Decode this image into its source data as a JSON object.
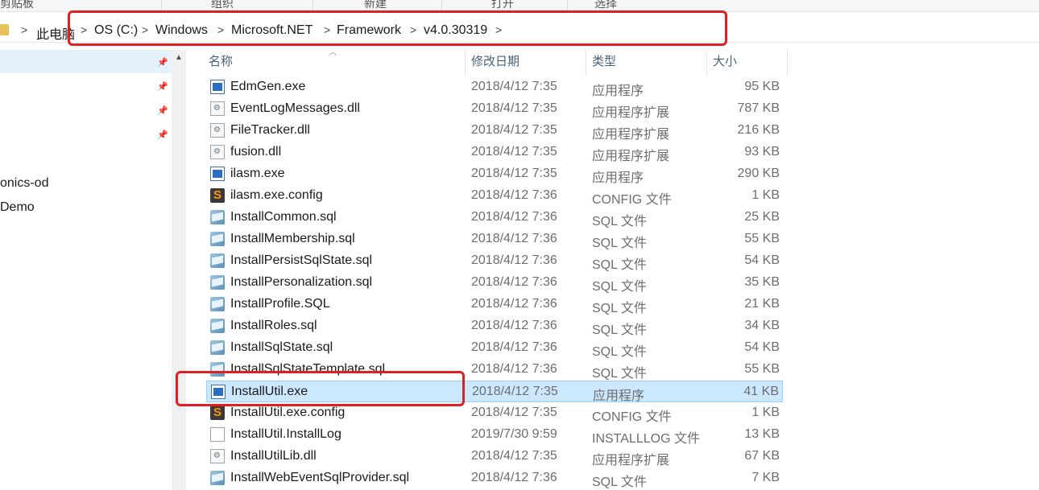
{
  "ribbon": {
    "groups": [
      "剪贴板",
      "组织",
      "新建",
      "打开",
      "选择"
    ]
  },
  "breadcrumb": [
    "此电脑",
    "OS (C:)",
    "Windows",
    "Microsoft.NET",
    "Framework",
    "v4.0.30319"
  ],
  "nav": {
    "items": [
      "onics-od",
      "Demo"
    ]
  },
  "columns": {
    "name": "名称",
    "date": "修改日期",
    "type": "类型",
    "size": "大小"
  },
  "files": [
    {
      "name": "EdmGen.exe",
      "date": "2018/4/12 7:35",
      "type": "应用程序",
      "size": "95 KB",
      "icon": "exe"
    },
    {
      "name": "EventLogMessages.dll",
      "date": "2018/4/12 7:35",
      "type": "应用程序扩展",
      "size": "787 KB",
      "icon": "dll"
    },
    {
      "name": "FileTracker.dll",
      "date": "2018/4/12 7:35",
      "type": "应用程序扩展",
      "size": "216 KB",
      "icon": "dll"
    },
    {
      "name": "fusion.dll",
      "date": "2018/4/12 7:35",
      "type": "应用程序扩展",
      "size": "93 KB",
      "icon": "dll"
    },
    {
      "name": "ilasm.exe",
      "date": "2018/4/12 7:35",
      "type": "应用程序",
      "size": "290 KB",
      "icon": "exe"
    },
    {
      "name": "ilasm.exe.config",
      "date": "2018/4/12 7:36",
      "type": "CONFIG 文件",
      "size": "1 KB",
      "icon": "config"
    },
    {
      "name": "InstallCommon.sql",
      "date": "2018/4/12 7:36",
      "type": "SQL 文件",
      "size": "25 KB",
      "icon": "sql"
    },
    {
      "name": "InstallMembership.sql",
      "date": "2018/4/12 7:36",
      "type": "SQL 文件",
      "size": "55 KB",
      "icon": "sql"
    },
    {
      "name": "InstallPersistSqlState.sql",
      "date": "2018/4/12 7:36",
      "type": "SQL 文件",
      "size": "54 KB",
      "icon": "sql"
    },
    {
      "name": "InstallPersonalization.sql",
      "date": "2018/4/12 7:36",
      "type": "SQL 文件",
      "size": "35 KB",
      "icon": "sql"
    },
    {
      "name": "InstallProfile.SQL",
      "date": "2018/4/12 7:36",
      "type": "SQL 文件",
      "size": "21 KB",
      "icon": "sql"
    },
    {
      "name": "InstallRoles.sql",
      "date": "2018/4/12 7:36",
      "type": "SQL 文件",
      "size": "34 KB",
      "icon": "sql"
    },
    {
      "name": "InstallSqlState.sql",
      "date": "2018/4/12 7:36",
      "type": "SQL 文件",
      "size": "54 KB",
      "icon": "sql"
    },
    {
      "name": "InstallSqlStateTemplate.sql",
      "date": "2018/4/12 7:36",
      "type": "SQL 文件",
      "size": "55 KB",
      "icon": "sql"
    },
    {
      "name": "InstallUtil.exe",
      "date": "2018/4/12 7:35",
      "type": "应用程序",
      "size": "41 KB",
      "icon": "exe",
      "selected": true
    },
    {
      "name": "InstallUtil.exe.config",
      "date": "2018/4/12 7:35",
      "type": "CONFIG 文件",
      "size": "1 KB",
      "icon": "config"
    },
    {
      "name": "InstallUtil.InstallLog",
      "date": "2019/7/30 9:59",
      "type": "INSTALLLOG 文件",
      "size": "13 KB",
      "icon": "log"
    },
    {
      "name": "InstallUtilLib.dll",
      "date": "2018/4/12 7:35",
      "type": "应用程序扩展",
      "size": "67 KB",
      "icon": "dll"
    },
    {
      "name": "InstallWebEventSqlProvider.sql",
      "date": "2018/4/12 7:36",
      "type": "SQL 文件",
      "size": "7 KB",
      "icon": "sql"
    }
  ],
  "colors": {
    "selection": "#cce8ff",
    "annotation": "#e02020"
  }
}
